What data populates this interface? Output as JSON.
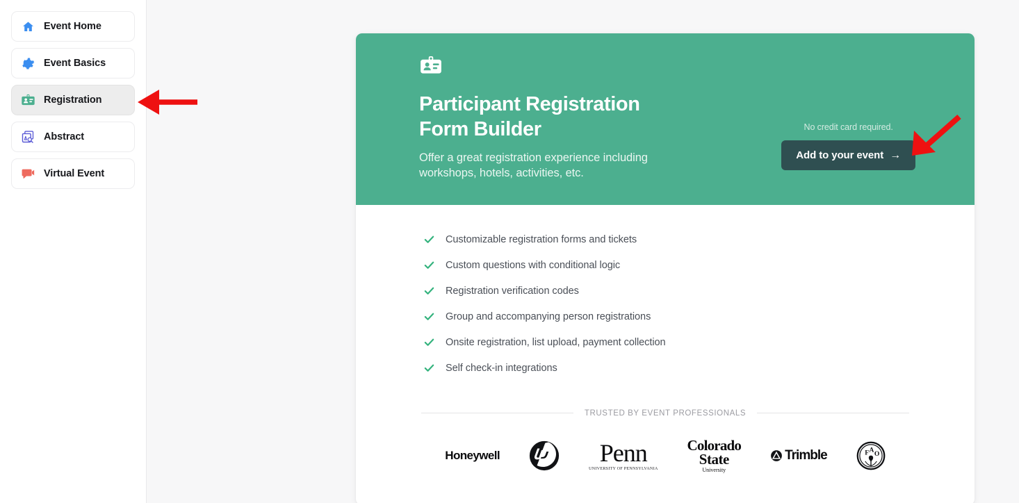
{
  "sidebar": {
    "items": [
      {
        "label": "Event Home",
        "icon": "home-icon",
        "selected": false
      },
      {
        "label": "Event Basics",
        "icon": "gear-icon",
        "selected": false
      },
      {
        "label": "Registration",
        "icon": "id-badge-icon",
        "selected": true
      },
      {
        "label": "Abstract",
        "icon": "document-search-icon",
        "selected": false
      },
      {
        "label": "Virtual Event",
        "icon": "video-chat-icon",
        "selected": false
      }
    ]
  },
  "hero": {
    "icon": "id-badge-icon",
    "title": "Participant Registration\nForm Builder",
    "subtitle": "Offer a great registration experience including\nworkshops, hotels, activities, etc.",
    "note": "No credit card required.",
    "cta_label": "Add to your event",
    "cta_arrow": "→",
    "bg_color": "#4caf8f",
    "cta_bg_color": "#2f4f51"
  },
  "features": [
    "Customizable registration forms and tickets",
    "Custom questions with conditional logic",
    "Registration verification codes",
    "Group and accompanying person registrations",
    "Onsite registration, list upload, payment collection",
    "Self check-in integrations"
  ],
  "trusted": {
    "caption": "TRUSTED BY EVENT PROFESSIONALS",
    "logos": [
      {
        "name": "Honeywell"
      },
      {
        "name": "hp"
      },
      {
        "name": "Penn",
        "sub": "University of Pennsylvania"
      },
      {
        "name": "Colorado State University",
        "l1": "Colorado",
        "l2": "State",
        "l3": "University"
      },
      {
        "name": "Trimble",
        "text": "Trimble"
      },
      {
        "name": "FAO",
        "letters": [
          "F",
          "A",
          "O"
        ]
      }
    ]
  },
  "annotations": [
    {
      "name": "arrow-pointing-to-registration",
      "color": "#ee1111",
      "direction": "left"
    },
    {
      "name": "arrow-pointing-to-cta",
      "color": "#ee1111",
      "direction": "down-left"
    }
  ]
}
